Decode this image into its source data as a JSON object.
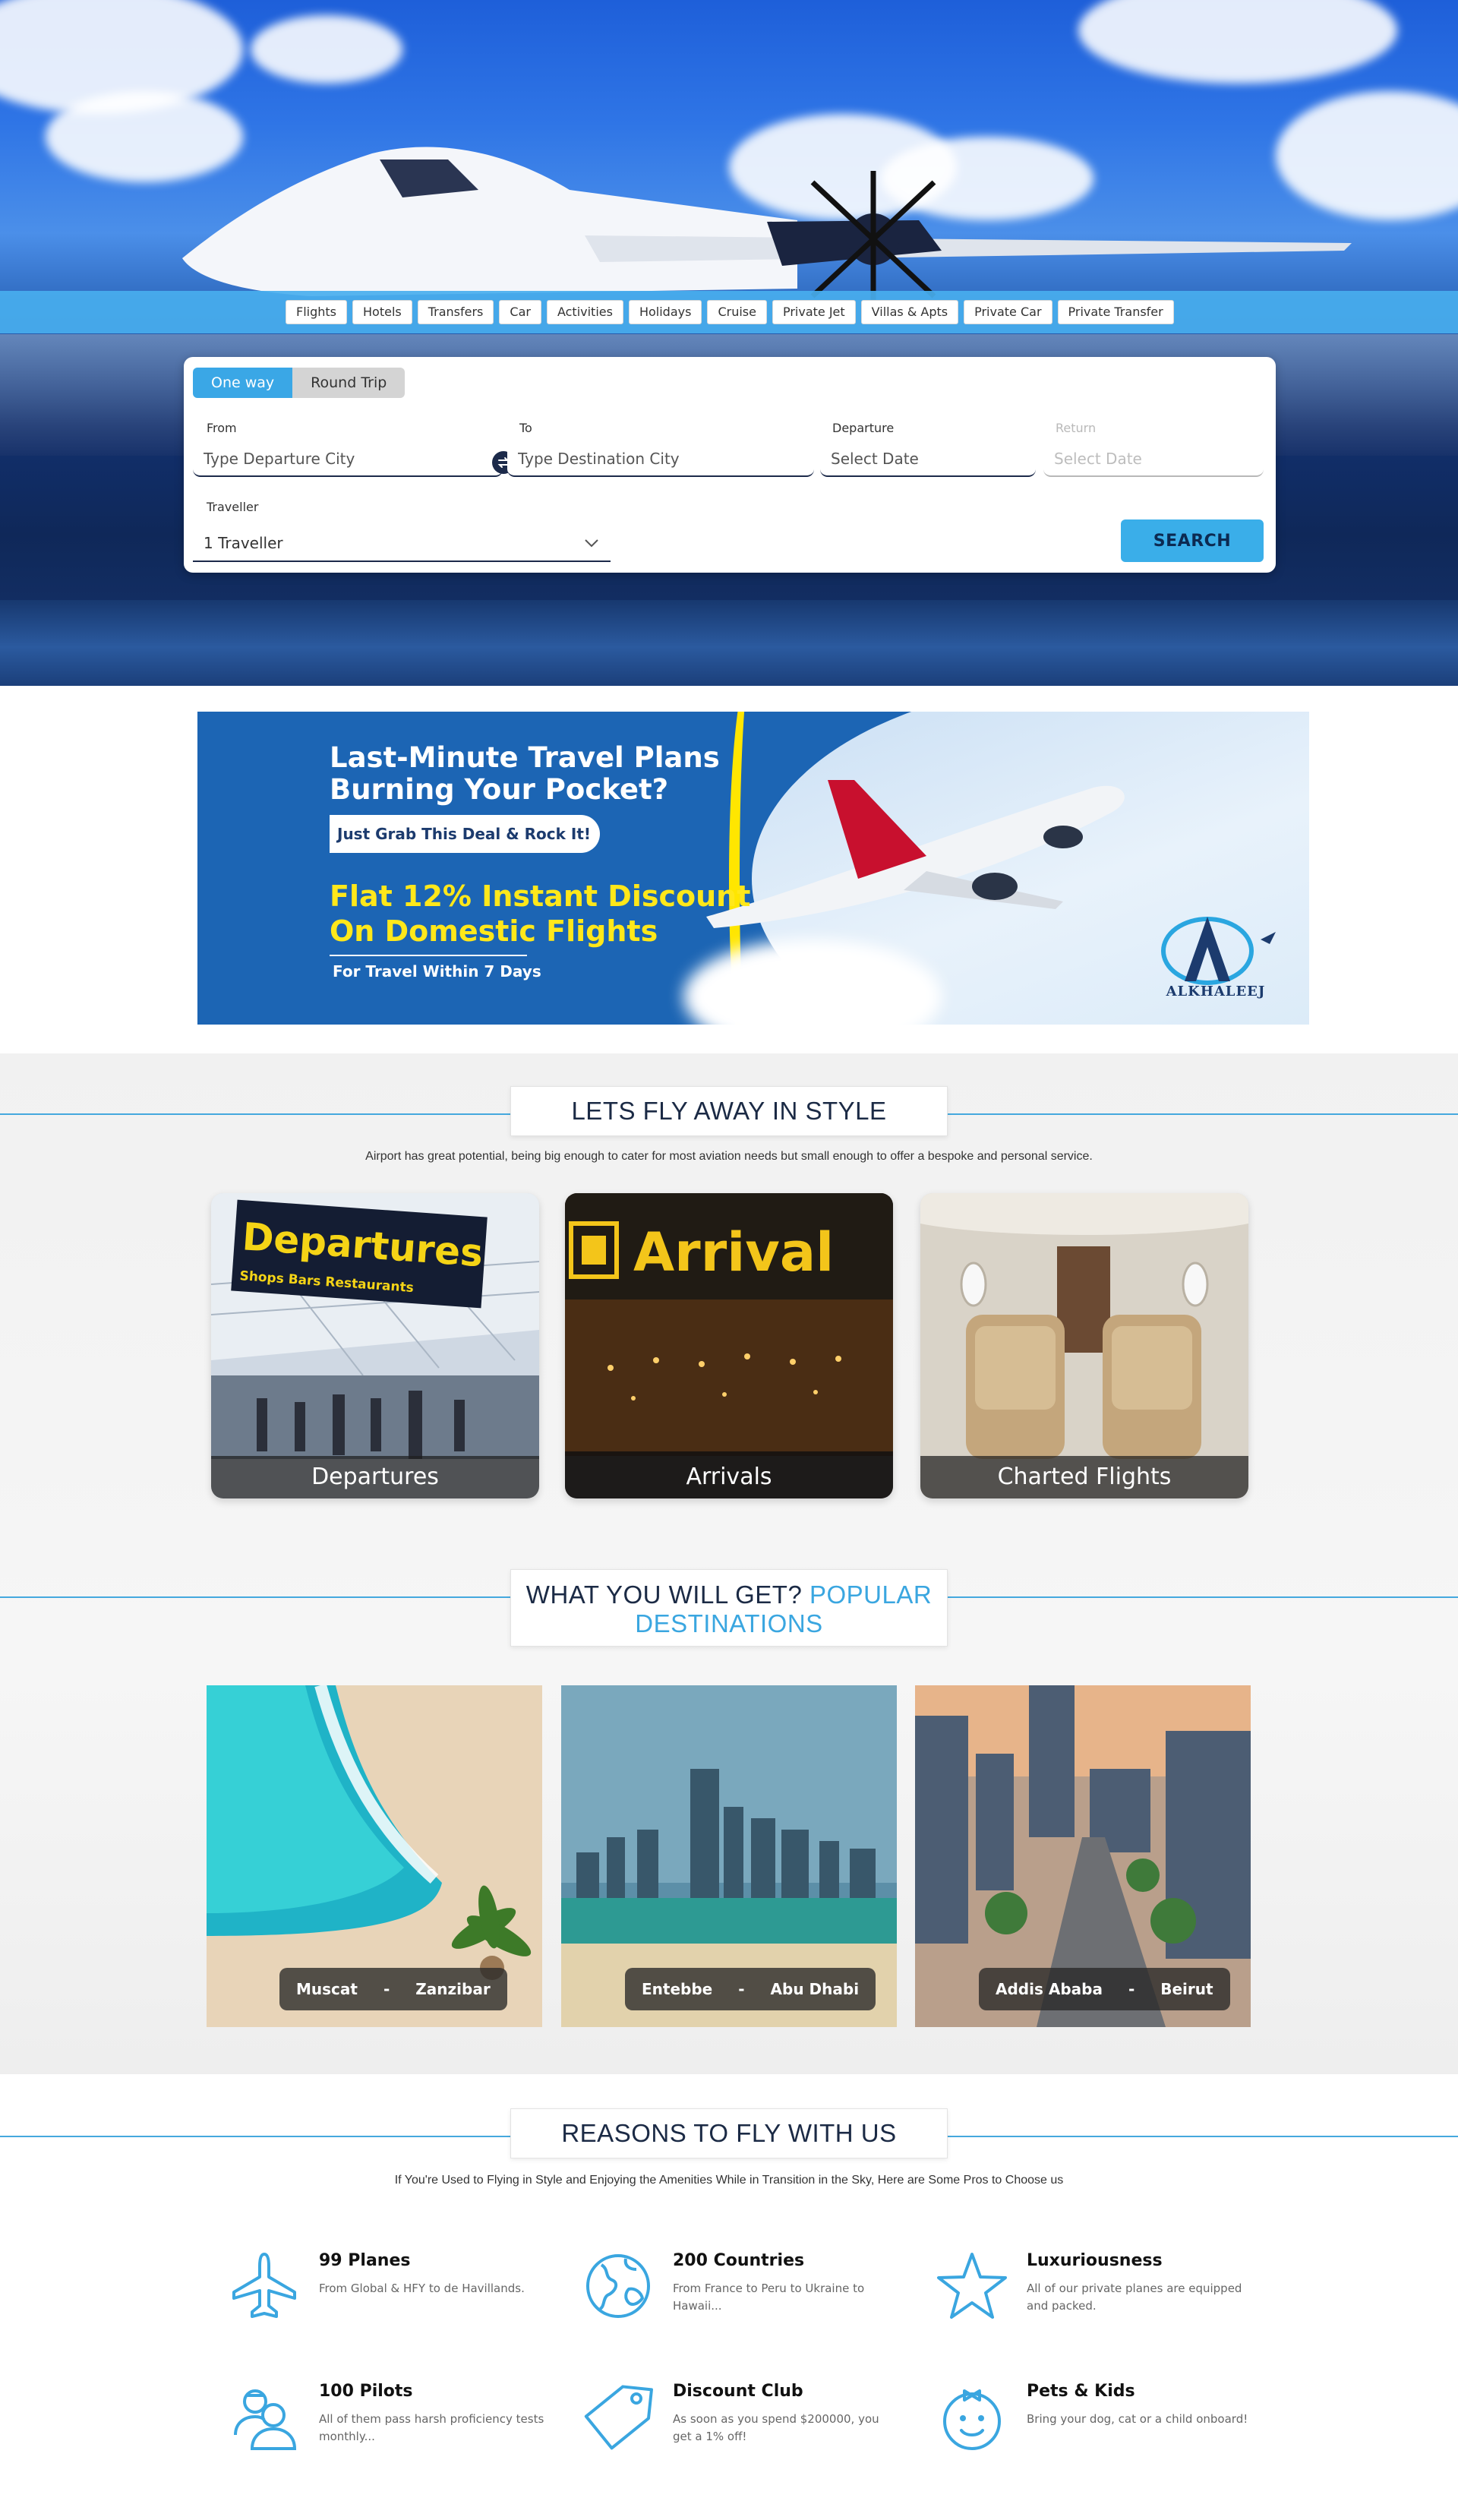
{
  "hero": {
    "tabs": [
      "Flights",
      "Hotels",
      "Transfers",
      "Car",
      "Activities",
      "Holidays",
      "Cruise",
      "Private Jet",
      "Villas & Apts",
      "Private Car",
      "Private Transfer"
    ]
  },
  "search": {
    "trip_types": [
      "One way",
      "Round Trip"
    ],
    "active_trip_type": "One way",
    "from_label": "From",
    "from_placeholder": "Type Departure City",
    "to_label": "To",
    "to_placeholder": "Type Destination City",
    "departure_label": "Departure",
    "departure_placeholder": "Select Date",
    "return_label": "Return",
    "return_placeholder": "Select Date",
    "traveller_label": "Traveller",
    "traveller_value": "1 Traveller",
    "search_label": "SEARCH"
  },
  "promo": {
    "headline": "Last-Minute Travel Plans Burning Your Pocket?",
    "pill": "Just Grab This Deal & Rock It!",
    "offer": "Flat 12% Instant Discount On Domestic Flights",
    "condition": "For Travel Within 7 Days",
    "logo_text": "ALKHALEEJ",
    "colors": {
      "blue": "#1c65b4",
      "yellow": "#ffe81a"
    }
  },
  "style_section": {
    "title": "LETS FLY AWAY IN STYLE",
    "subtitle": "Airport has great potential, being big enough to cater for most aviation needs but small enough to offer a bespoke and personal service.",
    "cards": [
      {
        "caption": "Departures",
        "sign_text": "Departures",
        "sign_sub": "Shops   Bars   Restaurants"
      },
      {
        "caption": "Arrivals",
        "sign_text": "Arrival"
      },
      {
        "caption": "Charted Flights"
      }
    ]
  },
  "destinations_section": {
    "title_main": "WHAT YOU WILL GET?",
    "title_accent": "POPULAR DESTINATIONS",
    "cards": [
      {
        "from": "Muscat",
        "sep": "-",
        "to": "Zanzibar"
      },
      {
        "from": "Entebbe",
        "sep": "-",
        "to": "Abu Dhabi"
      },
      {
        "from": "Addis Ababa",
        "sep": "-",
        "to": "Beirut"
      }
    ]
  },
  "reasons_section": {
    "title": "REASONS TO FLY WITH US",
    "subtitle": "If You're Used to Flying in Style and Enjoying the Amenities While in Transition in the Sky, Here are Some Pros to Choose us",
    "items": [
      {
        "title": "99 Planes",
        "text": "From Global & HFY to de Havillands.",
        "icon": "airplane-icon"
      },
      {
        "title": "200 Countries",
        "text": "From France to Peru to Ukraine to Hawaii...",
        "icon": "globe-icon"
      },
      {
        "title": "Luxuriousness",
        "text": "All of our private planes are equipped and packed.",
        "icon": "star-icon"
      },
      {
        "title": "100 Pilots",
        "text": "All of them pass harsh proficiency tests monthly...",
        "icon": "pilots-icon"
      },
      {
        "title": "Discount Club",
        "text": "As soon as you spend $200000, you get a 1% off!",
        "icon": "price-tag-icon"
      },
      {
        "title": "Pets & Kids",
        "text": "Bring your dog, cat or a child onboard!",
        "icon": "child-face-icon"
      }
    ],
    "accent_color": "#3aa6e0"
  }
}
